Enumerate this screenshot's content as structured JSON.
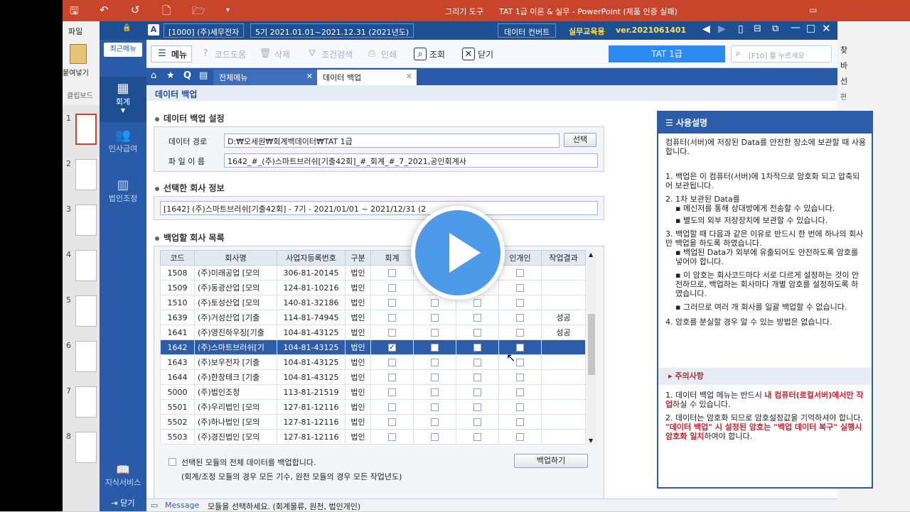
{
  "ppt": {
    "tab_drawing": "그리기 도구",
    "title": "TAT 1급 이론 & 실무 - PowerPoint (제품 인증 실패)",
    "ribbon_file": "파일",
    "paste": "붙여넣기",
    "clipboard": "클립보드",
    "slide_numbers": [
      "1",
      "2",
      "3",
      "4",
      "5",
      "6",
      "7",
      "8"
    ],
    "right_chars": [
      "찾",
      "바",
      "선",
      "편"
    ]
  },
  "app": {
    "company": "[1000] (주)세무전자",
    "period": "5기 2021.01.01~2021.12.31 (2021년도)",
    "data_convert": "데이터 컨버트",
    "edu_label": "실무교육용",
    "version": "ver.2021061401",
    "recent_menu": "최근메뉴",
    "toolbar": {
      "menu": "메뉴",
      "code_help": "코드도움",
      "delete": "삭제",
      "condition_search": "조건검색",
      "print": "인쇄",
      "inquiry": "조회",
      "close": "닫기"
    },
    "grade_label": "TAT 1급",
    "search_placeholder": "[F10] 를 누르세요",
    "nav": [
      "회계",
      "인사급여",
      "법인조정",
      "지식서비스",
      "닫기"
    ],
    "tabs": {
      "all_menu": "전체메뉴",
      "data_backup": "데이터 백업"
    },
    "page_title": "데이터 백업"
  },
  "backup": {
    "settings_title": "데이터 백업 설정",
    "path_label": "데이터 경로",
    "path_value": "D:₩오세원₩회계백데이터₩TAT 1급",
    "select_btn": "선택",
    "filename_label": "파 일 이 름",
    "filename_value": "1642_#_(주)스마트브러쉬[기출42회]_#_회계_#_7_2021,공인회계사",
    "selected_title": "선택한 회사 정보",
    "selected_value": "[1642] (주)스마트브러쉬[기출42회] - 7기 - 2021/01/01 ~ 2021/12/31 (2",
    "list_title": "백업할 회사 목록",
    "columns": [
      "코드",
      "회사명",
      "사업자등록번호",
      "구분",
      "회계",
      "",
      "",
      "인개인",
      "작업결과"
    ],
    "rows": [
      {
        "code": "1508",
        "name": "(주)미래공업 [모의",
        "bizno": "306-81-20145",
        "type": "법인",
        "cb": [
          0,
          0,
          0,
          0
        ],
        "result": ""
      },
      {
        "code": "1509",
        "name": "(주)동광산업 [모의",
        "bizno": "124-81-10216",
        "type": "법인",
        "cb": [
          0,
          0,
          0,
          0
        ],
        "result": ""
      },
      {
        "code": "1510",
        "name": "(주)토성산업 [모의",
        "bizno": "140-81-32186",
        "type": "법인",
        "cb": [
          0,
          0,
          0,
          0
        ],
        "result": ""
      },
      {
        "code": "1639",
        "name": "(주)거성산업 [기출",
        "bizno": "114-81-74945",
        "type": "법인",
        "cb": [
          0,
          0,
          0,
          0
        ],
        "result": "성공"
      },
      {
        "code": "1641",
        "name": "(주)영진하우징[기출",
        "bizno": "104-81-43125",
        "type": "법인",
        "cb": [
          0,
          0,
          0,
          0
        ],
        "result": "성공"
      },
      {
        "code": "1642",
        "name": "(주)스마트브러쉬[기",
        "bizno": "104-81-43125",
        "type": "법인",
        "cb": [
          1,
          0,
          0,
          0
        ],
        "result": "",
        "selected": true
      },
      {
        "code": "1643",
        "name": "(주)보우전자 [기출",
        "bizno": "104-81-43125",
        "type": "법인",
        "cb": [
          0,
          0,
          0,
          0
        ],
        "result": ""
      },
      {
        "code": "1644",
        "name": "(주)한창테크 [기출",
        "bizno": "104-81-43125",
        "type": "법인",
        "cb": [
          0,
          0,
          0,
          0
        ],
        "result": ""
      },
      {
        "code": "5000",
        "name": "(주)법인조정",
        "bizno": "113-81-21519",
        "type": "법인",
        "cb": [
          0,
          0,
          0,
          0
        ],
        "result": ""
      },
      {
        "code": "5501",
        "name": "(주)우리법인 [모의",
        "bizno": "127-81-12116",
        "type": "법인",
        "cb": [
          0,
          0,
          0,
          0
        ],
        "result": ""
      },
      {
        "code": "5502",
        "name": "(주)하나법인 [모의",
        "bizno": "127-81-12116",
        "type": "법인",
        "cb": [
          0,
          0,
          0,
          0
        ],
        "result": ""
      },
      {
        "code": "5503",
        "name": "(주)경진법인 [모의",
        "bizno": "127-81-12116",
        "type": "법인",
        "cb": [
          0,
          0,
          0,
          0
        ],
        "result": ""
      }
    ],
    "all_data_check": "선택된 모듈의 전체 데이터를 백업합니다.",
    "all_data_note": "(회계/조정 모듈의 경우 모든 기수, 원천 모듈의 경우 모든 작업년도)",
    "backup_btn": "백업하기"
  },
  "help": {
    "title": "사용설명",
    "intro": "컴퓨터(서버)에 저장된 Data를 안전한 장소에 보관할 때 사용합니다.",
    "item1": "백업은 이 컴퓨터(서버)에 1차적으로 암호화 되고 압축되어 보관됩니다.",
    "item2": "1차 보관된 Data를",
    "item2a": "메신저를 통해 상대방에게 전송할 수 있습니다.",
    "item2b": "별도의 외부 저장장치에 보관할 수 있습니다.",
    "item3": "백업할 때 다음과 같은 이유로 반드시 한 번에 하나의 회사만 백업을 하도록 하였습니다.",
    "item3a": "백업된 Data가 외부에 유출되어도 안전하도록 암호를 넣어야 합니다.",
    "item3b": "이 암호는 회사코드마다 서로 다르게 설정하는 것이 안전하므로, 백업하는 회사마다 개별 암호를 설정하도록 하였습니다.",
    "item3c": "그러므로 여러 개 회사를 일괄 백업할 수 없습니다.",
    "item4": "암호를 분실할 경우 알 수 있는 방법은 없습니다.",
    "warn_title": "주의사항",
    "warn1_pre": "데이터 백업 메뉴는 반드시 ",
    "warn1_red": "내 컴퓨터(로컬서버)에서만 작업",
    "warn1_post": "하실 수 있습니다.",
    "warn2_pre": "데이터는 암호화 되므로 암호설정값을 기억하셔야 합니다. ",
    "warn2_red": "\"데이터 백업\" 시 설정된 암호는 \"백업 데이터 복구\" 실행시 암호화 일치",
    "warn2_post": "하여야 합니다."
  },
  "message": {
    "label": "Message",
    "text": "모듈을 선택하세요. (회계물류, 원천, 법인개인)"
  }
}
